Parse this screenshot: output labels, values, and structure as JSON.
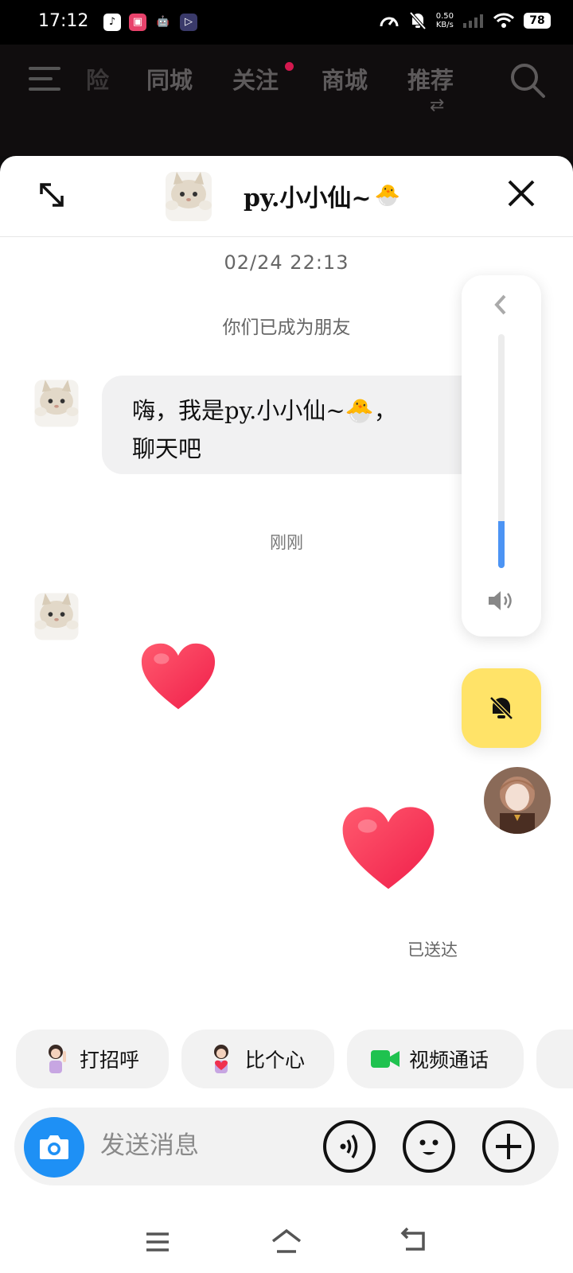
{
  "status_bar": {
    "time": "17:12",
    "net_speed_value": "0.50",
    "net_speed_unit": "KB/s",
    "battery": "78"
  },
  "top_nav": {
    "tabs": [
      "险",
      "同城",
      "关注",
      "商城",
      "推荐"
    ],
    "icons": [
      "menu-icon",
      "swap-icon",
      "search-icon"
    ]
  },
  "chat": {
    "contact_name": "py.小小仙~",
    "contact_emoji": "🐣",
    "timestamp_1": "02/24 22:13",
    "system_message": "你们已成为朋友",
    "bubble_line_1": "嗨，我是py.小小仙~🐣，",
    "bubble_line_2": "聊天吧",
    "timestamp_2": "刚刚",
    "sticker_1": "❤️",
    "sticker_2": "❤️",
    "delivered_status": "已送达"
  },
  "volume": {
    "level": 0.2
  },
  "quick_actions": [
    {
      "label": "打招呼"
    },
    {
      "label": "比个心"
    },
    {
      "label": "视频通话"
    }
  ],
  "composer": {
    "placeholder": "发送消息"
  },
  "colors": {
    "accent_blue": "#1e90f5",
    "volume_blue": "#4c94f4",
    "mute_yellow": "#ffe368",
    "nav_dot": "#d3184e",
    "video_green": "#1fc24f"
  }
}
